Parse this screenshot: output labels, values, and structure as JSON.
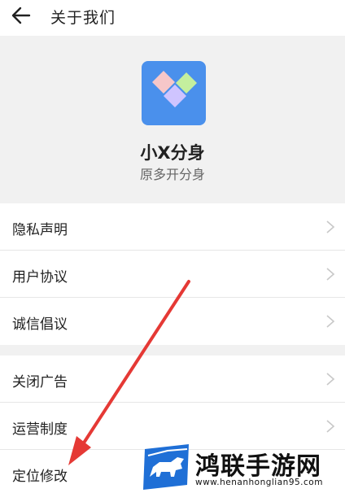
{
  "header": {
    "title": "关于我们"
  },
  "app": {
    "name": "小X分身",
    "subtitle": "原多开分身"
  },
  "group1": {
    "items": [
      {
        "label": "隐私声明"
      },
      {
        "label": "用户协议"
      },
      {
        "label": "诚信倡议"
      }
    ]
  },
  "group2": {
    "items": [
      {
        "label": "关闭广告"
      },
      {
        "label": "运营制度"
      },
      {
        "label": "定位修改"
      }
    ]
  },
  "watermark": {
    "title": "鸿联手游网",
    "url": "www.henanhonglian95.com"
  },
  "colors": {
    "app_icon_bg": "#4a90ec",
    "arrow": "#e53935",
    "logo_blue": "#1f6fd6"
  }
}
